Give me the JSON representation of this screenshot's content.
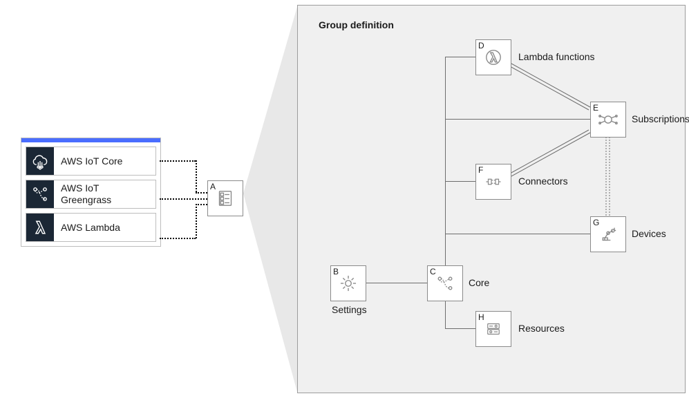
{
  "services": {
    "iot_core": "AWS IoT Core",
    "greengrass": "AWS IoT Greengrass",
    "lambda": "AWS Lambda"
  },
  "hub": {
    "tag": "A"
  },
  "group": {
    "title": "Group definition",
    "settings": {
      "tag": "B",
      "label": "Settings"
    },
    "core": {
      "tag": "C",
      "label": "Core"
    },
    "lambda": {
      "tag": "D",
      "label": "Lambda functions"
    },
    "subscriptions": {
      "tag": "E",
      "label": "Subscriptions"
    },
    "connectors": {
      "tag": "F",
      "label": "Connectors"
    },
    "devices": {
      "tag": "G",
      "label": "Devices"
    },
    "resources": {
      "tag": "H",
      "label": "Resources"
    }
  }
}
